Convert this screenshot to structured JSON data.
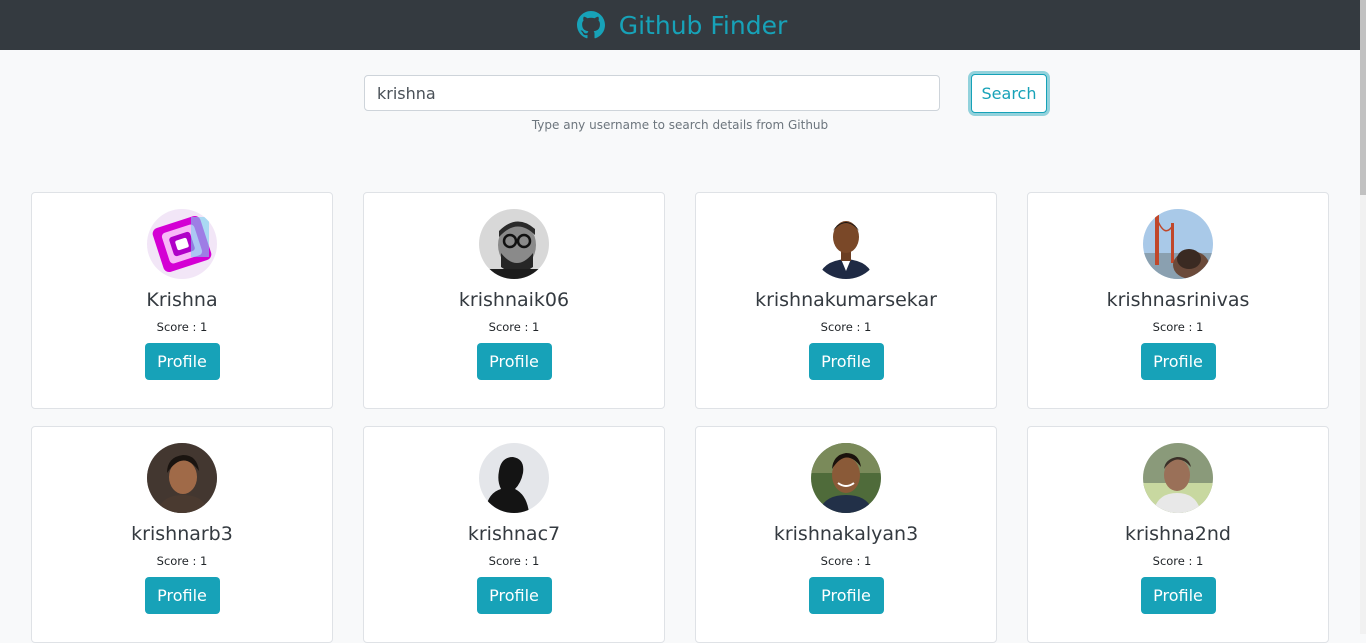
{
  "app": {
    "title": "Github Finder",
    "accent": "#17a2b8",
    "navbar_bg": "#343a40"
  },
  "search": {
    "value": "krishna",
    "placeholder": "",
    "button_label": "Search",
    "help_text": "Type any username to search details from Github"
  },
  "results": [
    {
      "login": "Krishna",
      "score": "Score : 1",
      "profile_label": "Profile",
      "avatar": "neon-abstract-avatar"
    },
    {
      "login": "krishnaik06",
      "score": "Score : 1",
      "profile_label": "Profile",
      "avatar": "bw-glasses-avatar"
    },
    {
      "login": "krishnakumarsekar",
      "score": "Score : 1",
      "profile_label": "Profile",
      "avatar": "suit-portrait-avatar"
    },
    {
      "login": "krishnasrinivas",
      "score": "Score : 1",
      "profile_label": "Profile",
      "avatar": "bridge-selfie-avatar"
    },
    {
      "login": "krishnarb3",
      "score": "Score : 1",
      "profile_label": "Profile",
      "avatar": "dark-portrait-avatar"
    },
    {
      "login": "krishnac7",
      "score": "Score : 1",
      "profile_label": "Profile",
      "avatar": "silhouette-avatar"
    },
    {
      "login": "krishnakalyan3",
      "score": "Score : 1",
      "profile_label": "Profile",
      "avatar": "smiling-portrait-avatar"
    },
    {
      "login": "krishna2nd",
      "score": "Score : 1",
      "profile_label": "Profile",
      "avatar": "outdoor-portrait-avatar"
    }
  ]
}
